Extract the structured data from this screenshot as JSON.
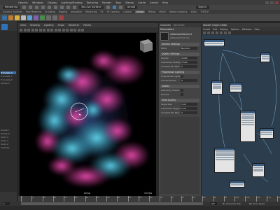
{
  "menubar": {
    "items": [
      "Generic",
      "Windows",
      "Display",
      "Lighting/Shading",
      "Texturing",
      "Render",
      "Toon",
      "Stereo",
      "Cache",
      "Arnold",
      "Help"
    ]
  },
  "status": {
    "workspace": "Rendering",
    "live_surface": "No Live Surface",
    "scene": "Sign In",
    "renderer": "Arnold"
  },
  "shelf_tabs": [
    "Curves / Surfaces",
    "Poly Modeling",
    "Sculpting",
    "Rigging",
    "Animation",
    "Rendering",
    "FX",
    "FX Caching",
    "Custom",
    "Arnold",
    "Bifrost",
    "MASH",
    "Motion Graphics",
    "XGen",
    "TURTLE"
  ],
  "shelf_active": "Arnold",
  "viewport": {
    "menu": [
      "View",
      "Shading",
      "Lighting",
      "Show",
      "Renderer",
      "Panels"
    ],
    "camera_label": "persp",
    "fps": "5.0 fps"
  },
  "attribute_panel": {
    "tabs": [
      "Channels",
      "Attributes"
    ],
    "title": "Parameters",
    "node_name": "aiStandardVolume1",
    "node_type": "aiStandardVolume",
    "sections": [
      {
        "title": "Volume Settings",
        "fields": [
          {
            "label": "Mode",
            "value": "Numeric"
          }
        ]
      },
      {
        "title": "Quality Settings",
        "fields": [
          {
            "label": "Quality",
            "value": "4.000"
          },
          {
            "label": "Interactive Quality",
            "value": "0.500"
          },
          {
            "label": "Coarsest Per Pass",
            "value": "2"
          }
        ]
      },
      {
        "title": "Progressive Lighting",
        "fields": [
          {
            "label": "Progressive Lighting",
            "value": ""
          },
          {
            "label": "Coarse Passes",
            "value": "4"
          }
        ]
      },
      {
        "title": "Quality",
        "fields": [
          {
            "label": "Geometry Shader",
            "value": ""
          },
          {
            "label": "Shadow",
            "value": ""
          }
        ]
      },
      {
        "title": "Multi Quality",
        "fields": [
          {
            "label": "Target Res",
            "value": "1.00"
          },
          {
            "label": "Interactive Target Res",
            "value": "1.00"
          },
          {
            "label": "Coarsest Per Pass",
            "value": "2"
          }
        ]
      }
    ]
  },
  "editor": {
    "title": "Shader Graph Editor",
    "menu": [
      "Create",
      "Edit",
      "Display",
      "Options",
      "Windows",
      "Help"
    ],
    "nodes": [
      "aiStandardVolume1",
      "volumeSampler",
      "aiRampRgb",
      "place2dTexture",
      "aiFloatToRgb",
      "layeredTexture",
      "aiMultiply",
      "aiUserDataFloat"
    ]
  },
  "timeline": {
    "ticks": [
      "1",
      "5",
      "10",
      "15",
      "20",
      "25",
      "30",
      "35",
      "40",
      "45",
      "50",
      "55",
      "60",
      "65",
      "70",
      "75",
      "80",
      "85",
      "90",
      "95",
      "100",
      "105",
      "110",
      "115",
      "120"
    ],
    "current_frame": "1",
    "range_start": "1",
    "range_end": "120",
    "character_set": "No Character Set",
    "anim_layer": "No Anim Layer"
  },
  "channels": {
    "rows": [
      "Translate X",
      "Translate Y",
      "Translate Z",
      "Rotate X",
      "Rotate Y",
      "Rotate Z",
      "Scale X",
      "Scale Y",
      "Scale Z",
      "Visibility"
    ]
  },
  "colors": {
    "accent": "#2f72b8",
    "magenta": "#c0348a",
    "cyan": "#35a8c6"
  }
}
